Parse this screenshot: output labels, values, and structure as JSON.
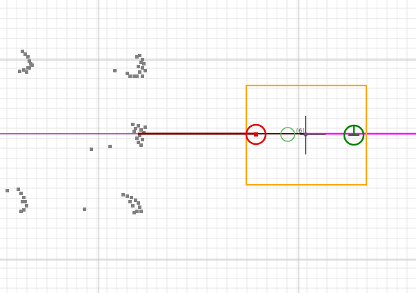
{
  "view": {
    "type": "2d-map-planner-view",
    "background": "#ffffff",
    "grid_minor_color": "#e6e6e6",
    "grid_major_color": "#bdbdbd",
    "obstacle_color": "#808080"
  },
  "robot": {
    "footprint_color": "#ffa500",
    "start_marker_color": "#e60000",
    "goal_marker_color": "#008000",
    "intermediate_marker_color": "#5cb85c",
    "heading_icon": "heading-tick-icon"
  },
  "paths": {
    "global_path_color": "#800080",
    "traveled_path_color": "#800000",
    "planned_path_color": "#ff00ff"
  },
  "annotation": {
    "waypoint_label": "(6)"
  }
}
